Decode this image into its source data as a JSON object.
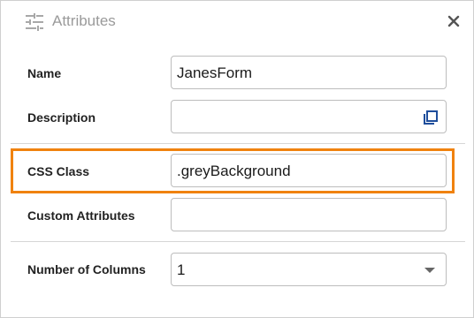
{
  "header": {
    "title": "Attributes",
    "settings_icon": "sliders-icon",
    "close_icon": "close-icon"
  },
  "fields": {
    "name": {
      "label": "Name",
      "value": "JanesForm"
    },
    "description": {
      "label": "Description",
      "value": "",
      "icon": "copy-icon"
    },
    "css_class": {
      "label": "CSS Class",
      "value": ".greyBackground"
    },
    "custom_attributes": {
      "label": "Custom Attributes",
      "value": ""
    },
    "number_of_columns": {
      "label": "Number of Columns",
      "value": "1"
    }
  },
  "colors": {
    "highlight": "#f0820f",
    "label_text": "#222222",
    "title_text": "#9a9a9a",
    "border": "#bdbdbd"
  }
}
